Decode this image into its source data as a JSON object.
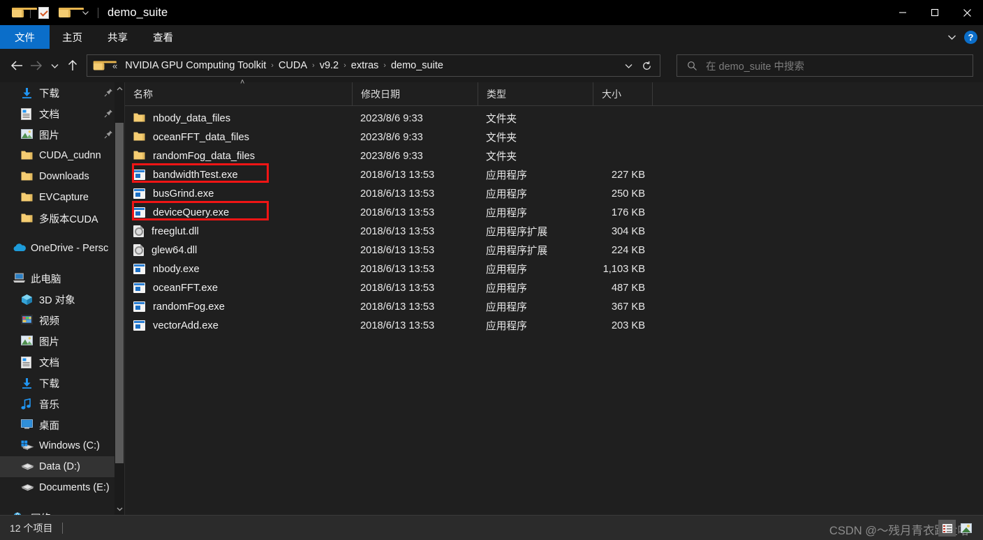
{
  "window": {
    "title": "demo_suite",
    "quick_access": [
      {
        "name": "quick-access-folder-icon",
        "icon": "folder-icon"
      },
      {
        "name": "quick-access-properties-icon",
        "icon": "properties-checkbox-icon"
      },
      {
        "name": "quick-access-new-folder-icon",
        "icon": "folder-icon"
      },
      {
        "name": "quick-access-dropdown",
        "icon": "chevron-down-icon"
      }
    ],
    "controls": {
      "minimize": "—",
      "maximize": "□",
      "close": "✕"
    }
  },
  "ribbon": {
    "tabs": [
      {
        "label": "文件",
        "name": "tab-file",
        "active": true
      },
      {
        "label": "主页",
        "name": "tab-home",
        "active": false
      },
      {
        "label": "共享",
        "name": "tab-share",
        "active": false
      },
      {
        "label": "查看",
        "name": "tab-view",
        "active": false
      }
    ],
    "collapse_icon": "chevron-down-icon",
    "help_label": "?"
  },
  "address_bar": {
    "back_icon": "arrow-left-icon",
    "forward_icon": "arrow-right-icon",
    "recent_icon": "chevron-down-icon",
    "up_icon": "arrow-up-icon",
    "overflow": "«",
    "breadcrumbs": [
      "NVIDIA GPU Computing Toolkit",
      "CUDA",
      "v9.2",
      "extras",
      "demo_suite"
    ],
    "separator": "›",
    "dropdown_icon": "chevron-down-icon",
    "refresh_icon": "refresh-icon"
  },
  "search": {
    "icon": "search-icon",
    "placeholder": "在 demo_suite 中搜索"
  },
  "sidebar": {
    "items": [
      {
        "label": "下载",
        "icon": "download-icon",
        "pinned": true,
        "level": 1,
        "selected": false
      },
      {
        "label": "文档",
        "icon": "document-icon",
        "pinned": true,
        "level": 1,
        "selected": false
      },
      {
        "label": "图片",
        "icon": "picture-icon",
        "pinned": true,
        "level": 1,
        "selected": false
      },
      {
        "label": "CUDA_cudnn",
        "icon": "folder-icon",
        "pinned": false,
        "level": 1,
        "selected": false
      },
      {
        "label": "Downloads",
        "icon": "folder-icon",
        "pinned": false,
        "level": 1,
        "selected": false
      },
      {
        "label": "EVCapture",
        "icon": "folder-icon",
        "pinned": false,
        "level": 1,
        "selected": false
      },
      {
        "label": "多版本CUDA",
        "icon": "folder-icon",
        "pinned": false,
        "level": 1,
        "selected": false
      },
      {
        "label": "OneDrive - Persc",
        "icon": "onedrive-icon",
        "pinned": false,
        "level": 0,
        "selected": false,
        "gap_before": true
      },
      {
        "label": "此电脑",
        "icon": "this-pc-icon",
        "pinned": false,
        "level": 0,
        "selected": false,
        "gap_before": true
      },
      {
        "label": "3D 对象",
        "icon": "3d-objects-icon",
        "pinned": false,
        "level": 1,
        "selected": false
      },
      {
        "label": "视频",
        "icon": "videos-icon",
        "pinned": false,
        "level": 1,
        "selected": false
      },
      {
        "label": "图片",
        "icon": "picture-icon",
        "pinned": false,
        "level": 1,
        "selected": false
      },
      {
        "label": "文档",
        "icon": "document-icon",
        "pinned": false,
        "level": 1,
        "selected": false
      },
      {
        "label": "下载",
        "icon": "download-icon",
        "pinned": false,
        "level": 1,
        "selected": false
      },
      {
        "label": "音乐",
        "icon": "music-icon",
        "pinned": false,
        "level": 1,
        "selected": false
      },
      {
        "label": "桌面",
        "icon": "desktop-icon",
        "pinned": false,
        "level": 1,
        "selected": false
      },
      {
        "label": "Windows (C:)",
        "icon": "windows-drive-icon",
        "pinned": false,
        "level": 1,
        "selected": false
      },
      {
        "label": "Data (D:)",
        "icon": "drive-icon",
        "pinned": false,
        "level": 1,
        "selected": true
      },
      {
        "label": "Documents (E:)",
        "icon": "drive-icon",
        "pinned": false,
        "level": 1,
        "selected": false
      },
      {
        "label": "网络",
        "icon": "network-icon",
        "pinned": false,
        "level": 0,
        "selected": false,
        "gap_before": true
      }
    ],
    "scroll_up_icon": "chevron-up-icon",
    "scroll_down_icon": "chevron-down-icon"
  },
  "file_list": {
    "columns": [
      {
        "label": "名称",
        "name": "column-header-name",
        "sorted": "asc"
      },
      {
        "label": "修改日期",
        "name": "column-header-date"
      },
      {
        "label": "类型",
        "name": "column-header-type"
      },
      {
        "label": "大小",
        "name": "column-header-size"
      }
    ],
    "sort_caret": "˄",
    "rows": [
      {
        "name": "nbody_data_files",
        "icon": "folder-icon",
        "date": "2023/8/6 9:33",
        "type": "文件夹",
        "size": ""
      },
      {
        "name": "oceanFFT_data_files",
        "icon": "folder-icon",
        "date": "2023/8/6 9:33",
        "type": "文件夹",
        "size": ""
      },
      {
        "name": "randomFog_data_files",
        "icon": "folder-icon",
        "date": "2023/8/6 9:33",
        "type": "文件夹",
        "size": ""
      },
      {
        "name": "bandwidthTest.exe",
        "icon": "exe-icon",
        "date": "2018/6/13 13:53",
        "type": "应用程序",
        "size": "227 KB"
      },
      {
        "name": "busGrind.exe",
        "icon": "exe-icon",
        "date": "2018/6/13 13:53",
        "type": "应用程序",
        "size": "250 KB"
      },
      {
        "name": "deviceQuery.exe",
        "icon": "exe-icon",
        "date": "2018/6/13 13:53",
        "type": "应用程序",
        "size": "176 KB"
      },
      {
        "name": "freeglut.dll",
        "icon": "dll-icon",
        "date": "2018/6/13 13:53",
        "type": "应用程序扩展",
        "size": "304 KB"
      },
      {
        "name": "glew64.dll",
        "icon": "dll-icon",
        "date": "2018/6/13 13:53",
        "type": "应用程序扩展",
        "size": "224 KB"
      },
      {
        "name": "nbody.exe",
        "icon": "exe-icon",
        "date": "2018/6/13 13:53",
        "type": "应用程序",
        "size": "1,103 KB"
      },
      {
        "name": "oceanFFT.exe",
        "icon": "exe-icon",
        "date": "2018/6/13 13:53",
        "type": "应用程序",
        "size": "487 KB"
      },
      {
        "name": "randomFog.exe",
        "icon": "exe-icon",
        "date": "2018/6/13 13:53",
        "type": "应用程序",
        "size": "367 KB"
      },
      {
        "name": "vectorAdd.exe",
        "icon": "exe-icon",
        "date": "2018/6/13 13:53",
        "type": "应用程序",
        "size": "203 KB"
      }
    ],
    "highlights": [
      {
        "target": "bandwidthTest.exe",
        "color": "#f01515"
      },
      {
        "target": "deviceQuery.exe",
        "color": "#f01515"
      }
    ]
  },
  "status_bar": {
    "item_count": "12 个项目",
    "watermark": "CSDN @～残月青衣踏尘哈",
    "view_details_icon": "details-view-icon",
    "view_thumbnails_icon": "large-icons-view-icon"
  },
  "colors": {
    "accent": "#0b6ec9",
    "highlight": "#f01515",
    "folder": "#f5cd72",
    "background": "#1f1f1f"
  }
}
